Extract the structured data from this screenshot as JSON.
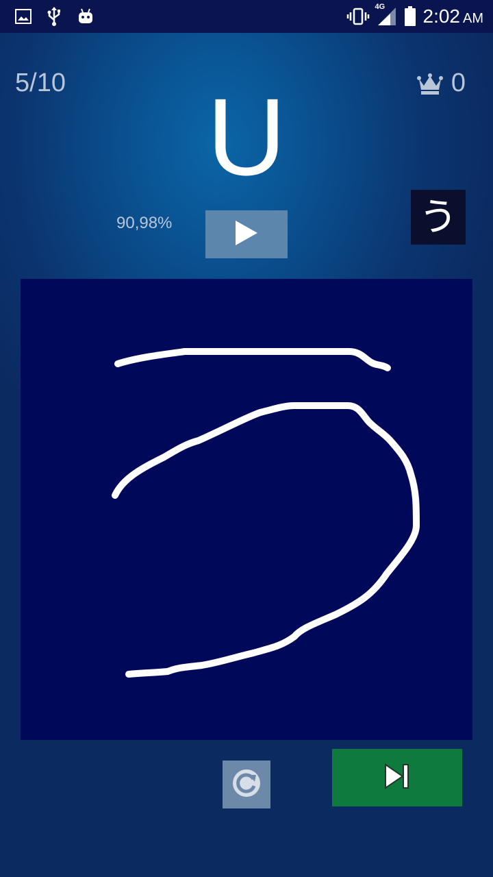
{
  "status_bar": {
    "time": "2:02",
    "ampm": "AM",
    "network": "4G",
    "icons": [
      "gallery-icon",
      "usb-icon",
      "android-icon",
      "vibrate-icon",
      "signal-icon",
      "battery-icon"
    ]
  },
  "quiz": {
    "progress": "5/10",
    "score": "0",
    "romaji": "U",
    "accuracy": "90,98%",
    "hint_kana": "う"
  },
  "colors": {
    "canvas_bg": "#00085a",
    "next_button": "#0f7a3d",
    "play_button": "#5d86ad",
    "stroke": "#ffffff"
  }
}
